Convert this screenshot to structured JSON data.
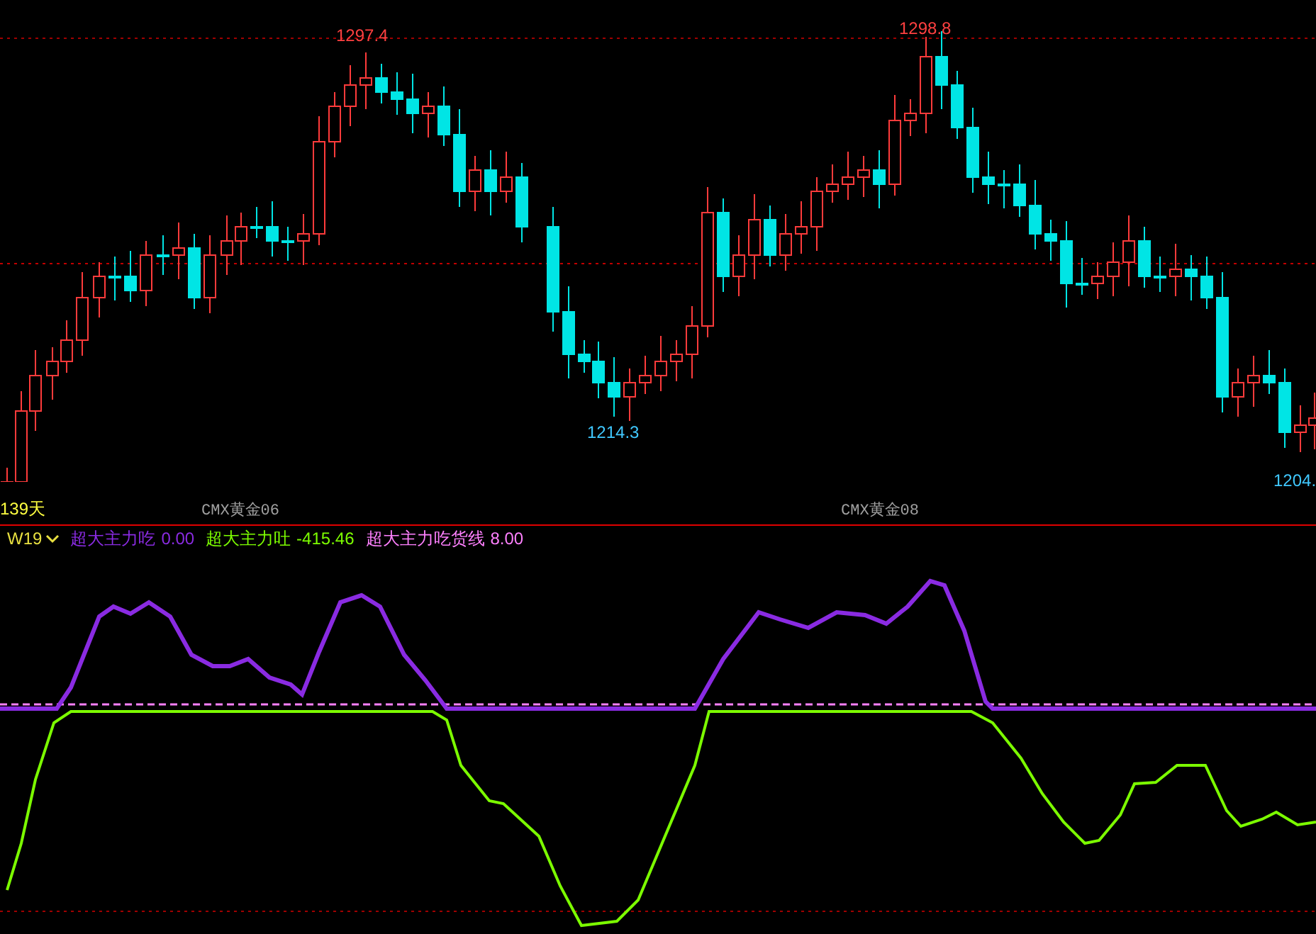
{
  "price_panel": {
    "extreme_labels": [
      {
        "text": "1297.4",
        "kind": "high"
      },
      {
        "text": "1298.8",
        "kind": "high"
      },
      {
        "text": "1214.3",
        "kind": "low"
      },
      {
        "text": "1204.",
        "kind": "low"
      }
    ],
    "period_label": "139天",
    "contract_labels": [
      "CMX黄金06",
      "CMX黄金08"
    ]
  },
  "indicator_panel": {
    "name": "W19",
    "series": [
      {
        "label": "超大主力吃",
        "value": "0.00",
        "color": "#8a2be2"
      },
      {
        "label": "超大主力吐",
        "value": "-415.46",
        "color": "#7cfc00"
      },
      {
        "label": "超大主力吃货线",
        "value": "8.00",
        "color": "#ff80ff"
      }
    ]
  }
}
